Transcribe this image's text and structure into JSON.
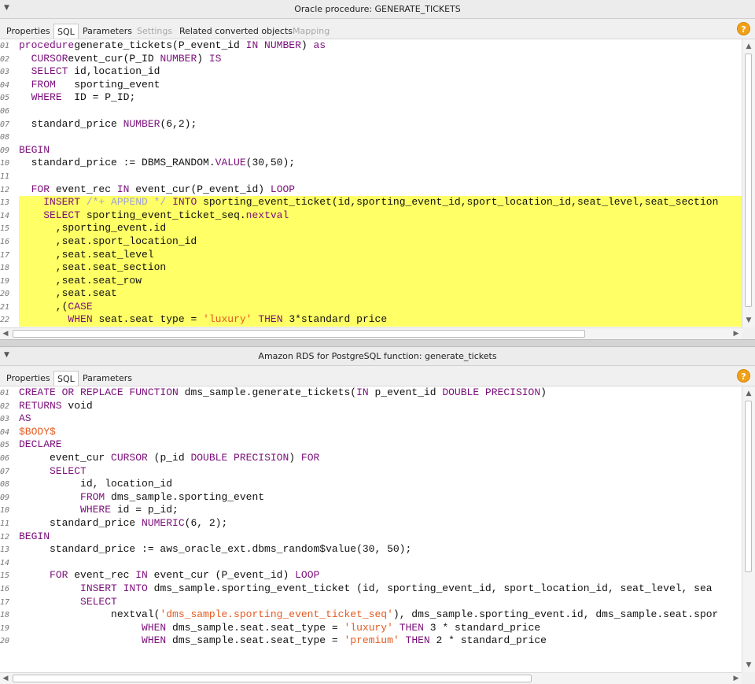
{
  "panel1": {
    "title": "Oracle procedure: GENERATE_TICKETS",
    "tabs": [
      {
        "label": "Properties",
        "state": "normal"
      },
      {
        "label": "SQL",
        "state": "active"
      },
      {
        "label": "Parameters",
        "state": "normal"
      },
      {
        "label": "Settings",
        "state": "disabled"
      },
      {
        "label": "Related converted objects",
        "state": "normal"
      },
      {
        "label": "Mapping",
        "state": "disabled"
      }
    ],
    "help_label": "?",
    "lines": [
      {
        "n": "01",
        "hl": false,
        "segs": [
          [
            "kw",
            "procedure"
          ],
          [
            "",
            "generate_tickets(P_event_id "
          ],
          [
            "kw",
            "IN NUMBER"
          ],
          [
            "",
            ") "
          ],
          [
            "kw",
            "as"
          ]
        ]
      },
      {
        "n": "02",
        "hl": false,
        "segs": [
          [
            "",
            "  "
          ],
          [
            "kw",
            "CURSOR"
          ],
          [
            "",
            "event_cur(P_ID "
          ],
          [
            "kw",
            "NUMBER"
          ],
          [
            "",
            ") "
          ],
          [
            "kw",
            "IS"
          ]
        ]
      },
      {
        "n": "03",
        "hl": false,
        "segs": [
          [
            "",
            "  "
          ],
          [
            "kw",
            "SELECT"
          ],
          [
            "",
            " id,location_id"
          ]
        ]
      },
      {
        "n": "04",
        "hl": false,
        "segs": [
          [
            "",
            "  "
          ],
          [
            "kw",
            "FROM"
          ],
          [
            "",
            "   sporting_event"
          ]
        ]
      },
      {
        "n": "05",
        "hl": false,
        "segs": [
          [
            "",
            "  "
          ],
          [
            "kw",
            "WHERE"
          ],
          [
            "",
            "  ID = P_ID;"
          ]
        ]
      },
      {
        "n": "06",
        "hl": false,
        "segs": []
      },
      {
        "n": "07",
        "hl": false,
        "segs": [
          [
            "",
            "  standard_price "
          ],
          [
            "kw",
            "NUMBER"
          ],
          [
            "",
            "(6,2);"
          ]
        ]
      },
      {
        "n": "08",
        "hl": false,
        "segs": []
      },
      {
        "n": "09",
        "hl": false,
        "segs": [
          [
            "kw",
            "BEGIN"
          ]
        ]
      },
      {
        "n": "10",
        "hl": false,
        "segs": [
          [
            "",
            "  standard_price := DBMS_RANDOM."
          ],
          [
            "kw",
            "VALUE"
          ],
          [
            "",
            "(30,50);"
          ]
        ]
      },
      {
        "n": "11",
        "hl": false,
        "segs": []
      },
      {
        "n": "12",
        "hl": false,
        "segs": [
          [
            "",
            "  "
          ],
          [
            "kw",
            "FOR"
          ],
          [
            "",
            " event_rec "
          ],
          [
            "kw",
            "IN"
          ],
          [
            "",
            " event_cur(P_event_id) "
          ],
          [
            "kw",
            "LOOP"
          ]
        ]
      },
      {
        "n": "13",
        "hl": true,
        "segs": [
          [
            "",
            "    "
          ],
          [
            "kw",
            "INSERT"
          ],
          [
            "",
            ""
          ],
          [
            "cm",
            " /*+ APPEND */ "
          ],
          [
            "kw",
            "INTO"
          ],
          [
            "",
            " sporting_event_ticket(id,sporting_event_id,sport_location_id,seat_level,seat_section"
          ]
        ]
      },
      {
        "n": "14",
        "hl": true,
        "segs": [
          [
            "",
            "    "
          ],
          [
            "kw",
            "SELECT"
          ],
          [
            "",
            " sporting_event_ticket_seq."
          ],
          [
            "kw",
            "nextval"
          ]
        ]
      },
      {
        "n": "15",
        "hl": true,
        "segs": [
          [
            "",
            "      ,sporting_event.id"
          ]
        ]
      },
      {
        "n": "16",
        "hl": true,
        "segs": [
          [
            "",
            "      ,seat.sport_location_id"
          ]
        ]
      },
      {
        "n": "17",
        "hl": true,
        "segs": [
          [
            "",
            "      ,seat.seat_level"
          ]
        ]
      },
      {
        "n": "18",
        "hl": true,
        "segs": [
          [
            "",
            "      ,seat.seat_section"
          ]
        ]
      },
      {
        "n": "19",
        "hl": true,
        "segs": [
          [
            "",
            "      ,seat.seat_row"
          ]
        ]
      },
      {
        "n": "20",
        "hl": true,
        "segs": [
          [
            "",
            "      ,seat.seat"
          ]
        ]
      },
      {
        "n": "21",
        "hl": true,
        "segs": [
          [
            "",
            "      ,("
          ],
          [
            "kw",
            "CASE"
          ]
        ]
      },
      {
        "n": "22",
        "hl": true,
        "segs": [
          [
            "",
            "        "
          ],
          [
            "kw",
            "WHEN"
          ],
          [
            "",
            " seat.seat type = "
          ],
          [
            "str",
            "'luxury'"
          ],
          [
            "",
            " "
          ],
          [
            "kw",
            "THEN"
          ],
          [
            "",
            " 3*standard price"
          ]
        ]
      }
    ]
  },
  "panel2": {
    "title": "Amazon RDS for PostgreSQL function: generate_tickets",
    "tabs": [
      {
        "label": "Properties",
        "state": "normal"
      },
      {
        "label": "SQL",
        "state": "active"
      },
      {
        "label": "Parameters",
        "state": "normal"
      }
    ],
    "help_label": "?",
    "lines": [
      {
        "n": "01",
        "hl": false,
        "segs": [
          [
            "kw",
            "CREATE OR REPLACE FUNCTION"
          ],
          [
            "",
            " dms_sample.generate_tickets("
          ],
          [
            "kw",
            "IN"
          ],
          [
            "",
            " p_event_id "
          ],
          [
            "kw",
            "DOUBLE PRECISION"
          ],
          [
            "",
            ")"
          ]
        ]
      },
      {
        "n": "02",
        "hl": false,
        "segs": [
          [
            "kw",
            "RETURNS"
          ],
          [
            "",
            " void"
          ]
        ]
      },
      {
        "n": "03",
        "hl": false,
        "segs": [
          [
            "kw",
            "AS"
          ]
        ]
      },
      {
        "n": "04",
        "hl": false,
        "segs": [
          [
            "str",
            "$BODY$"
          ]
        ]
      },
      {
        "n": "05",
        "hl": false,
        "segs": [
          [
            "kw",
            "DECLARE"
          ]
        ]
      },
      {
        "n": "06",
        "hl": false,
        "segs": [
          [
            "",
            "     event_cur "
          ],
          [
            "kw",
            "CURSOR"
          ],
          [
            "",
            " (p_id "
          ],
          [
            "kw",
            "DOUBLE PRECISION"
          ],
          [
            "",
            ") "
          ],
          [
            "kw",
            "FOR"
          ]
        ]
      },
      {
        "n": "07",
        "hl": false,
        "segs": [
          [
            "",
            "     "
          ],
          [
            "kw",
            "SELECT"
          ]
        ]
      },
      {
        "n": "08",
        "hl": false,
        "segs": [
          [
            "",
            "          id, location_id"
          ]
        ]
      },
      {
        "n": "09",
        "hl": false,
        "segs": [
          [
            "",
            "          "
          ],
          [
            "kw",
            "FROM"
          ],
          [
            "",
            " dms_sample.sporting_event"
          ]
        ]
      },
      {
        "n": "10",
        "hl": false,
        "segs": [
          [
            "",
            "          "
          ],
          [
            "kw",
            "WHERE"
          ],
          [
            "",
            " id = p_id;"
          ]
        ]
      },
      {
        "n": "11",
        "hl": false,
        "segs": [
          [
            "",
            "     standard_price "
          ],
          [
            "kw",
            "NUMERIC"
          ],
          [
            "",
            "(6, 2);"
          ]
        ]
      },
      {
        "n": "12",
        "hl": false,
        "segs": [
          [
            "kw",
            "BEGIN"
          ]
        ]
      },
      {
        "n": "13",
        "hl": false,
        "segs": [
          [
            "",
            "     standard_price := aws_oracle_ext.dbms_random$value(30, 50);"
          ]
        ]
      },
      {
        "n": "14",
        "hl": false,
        "segs": []
      },
      {
        "n": "15",
        "hl": false,
        "segs": [
          [
            "",
            "     "
          ],
          [
            "kw",
            "FOR"
          ],
          [
            "",
            " event_rec "
          ],
          [
            "kw",
            "IN"
          ],
          [
            "",
            " event_cur (P_event_id) "
          ],
          [
            "kw",
            "LOOP"
          ]
        ]
      },
      {
        "n": "16",
        "hl": false,
        "segs": [
          [
            "",
            "          "
          ],
          [
            "kw",
            "INSERT INTO"
          ],
          [
            "",
            " dms_sample.sporting_event_ticket (id, sporting_event_id, sport_location_id, seat_level, sea"
          ]
        ]
      },
      {
        "n": "17",
        "hl": false,
        "segs": [
          [
            "",
            "          "
          ],
          [
            "kw",
            "SELECT"
          ]
        ]
      },
      {
        "n": "18",
        "hl": false,
        "segs": [
          [
            "",
            "               nextval("
          ],
          [
            "str",
            "'dms_sample.sporting_event_ticket_seq'"
          ],
          [
            "",
            "), dms_sample.sporting_event.id, dms_sample.seat.spor"
          ]
        ]
      },
      {
        "n": "19",
        "hl": false,
        "segs": [
          [
            "",
            "                    "
          ],
          [
            "kw",
            "WHEN"
          ],
          [
            "",
            " dms_sample.seat.seat_type = "
          ],
          [
            "str",
            "'luxury'"
          ],
          [
            "",
            " "
          ],
          [
            "kw",
            "THEN"
          ],
          [
            "",
            " 3 * standard_price"
          ]
        ]
      },
      {
        "n": "20",
        "hl": false,
        "segs": [
          [
            "",
            "                    "
          ],
          [
            "kw",
            "WHEN"
          ],
          [
            "",
            " dms_sample.seat.seat_type = "
          ],
          [
            "str",
            "'premium'"
          ],
          [
            "",
            " "
          ],
          [
            "kw",
            "THEN"
          ],
          [
            "",
            " 2 * standard_price"
          ]
        ]
      }
    ]
  },
  "icons": {
    "collapse": "▼",
    "scroll_up": "▲",
    "scroll_down": "▼",
    "scroll_left": "◀",
    "scroll_right": "▶"
  }
}
